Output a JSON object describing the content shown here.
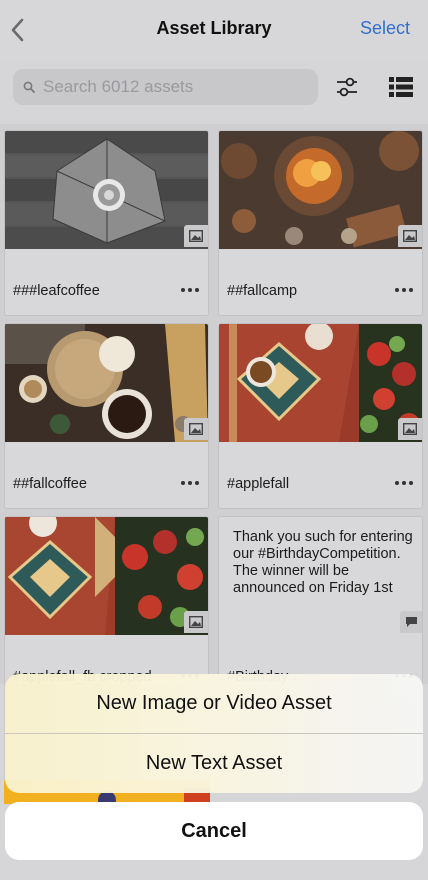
{
  "nav": {
    "title": "Asset Library",
    "select_label": "Select",
    "back_icon": "chevron-left-icon"
  },
  "search": {
    "placeholder": "Search 6012 assets",
    "value": ""
  },
  "toolbar": {
    "filter_icon": "sliders-icon",
    "view_icon": "list-view-icon"
  },
  "assets": [
    {
      "label": "###leafcoffee",
      "type": "image"
    },
    {
      "label": "##fallcamp",
      "type": "image"
    },
    {
      "label": "##fallcoffee",
      "type": "image"
    },
    {
      "label": "#applefall",
      "type": "image"
    },
    {
      "label": "#applefall_fb cropped",
      "type": "image"
    },
    {
      "label": "#Birthday",
      "type": "text",
      "preview": "Thank you such for entering our #BirthdayCompetition. The winner will be announced on Friday 1st"
    }
  ],
  "action_sheet": {
    "options": [
      "New Image or Video Asset",
      "New Text Asset"
    ],
    "cancel_label": "Cancel"
  },
  "colors": {
    "accent": "#2f6fd0",
    "dimmed_background": "#d6d6d8",
    "sheet_tint": "#faf2cd"
  }
}
